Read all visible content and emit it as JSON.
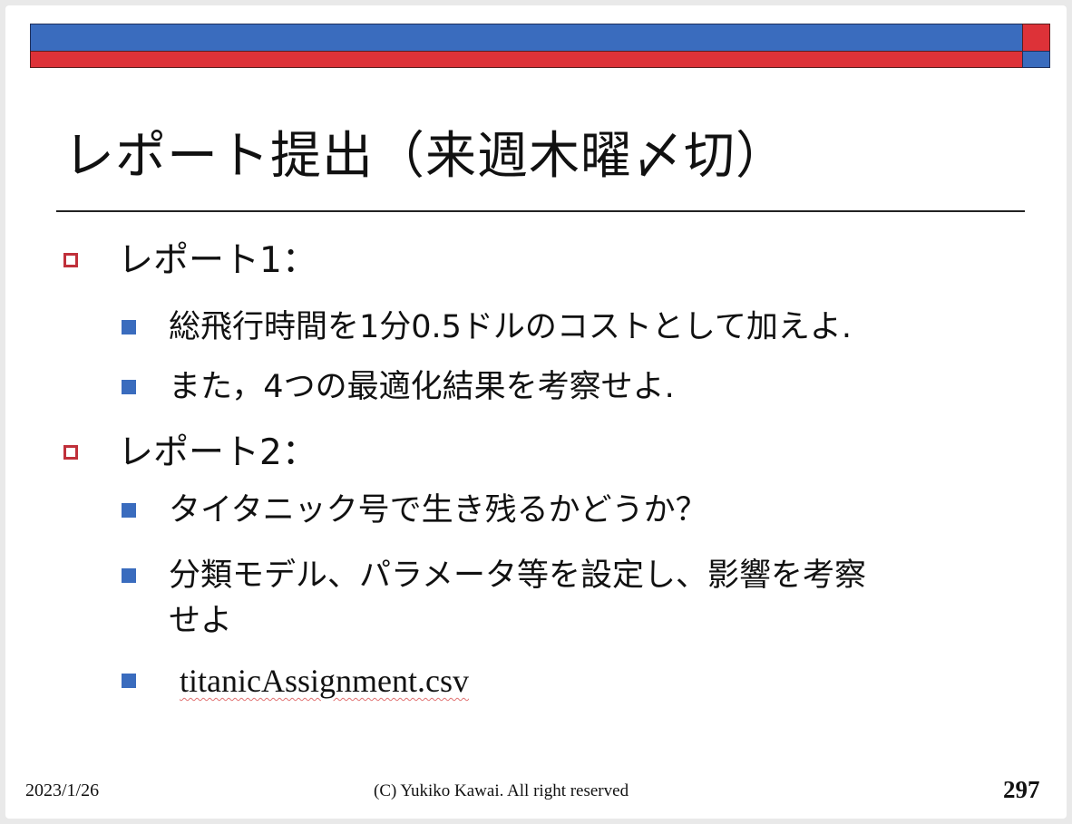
{
  "slide": {
    "title": "レポート提出（来週木曜〆切）",
    "items": [
      {
        "label": "レポート1：",
        "subitems": [
          "総飛行時間を1分0.5ドルのコストとして加えよ.",
          "また，4つの最適化結果を考察せよ."
        ]
      },
      {
        "label": "レポート2：",
        "subitems": [
          "タイタニック号で生き残るかどうか？",
          "分類モデル、パラメータ等を設定し、影響を考察",
          "せよ",
          "titanicAssignment.csv"
        ]
      }
    ],
    "footer": {
      "date": "2023/1/26",
      "copyright": "(C) Yukiko Kawai. All right reserved",
      "page_number": "297"
    }
  },
  "colors": {
    "bar_blue": "#3a6cbe",
    "bar_red": "#dd3238",
    "bullet_outline": "#c0303a",
    "bullet_fill": "#3a6cbe"
  },
  "icons": {
    "level1_bullet": "hollow-square-icon",
    "level2_bullet": "filled-square-icon"
  }
}
